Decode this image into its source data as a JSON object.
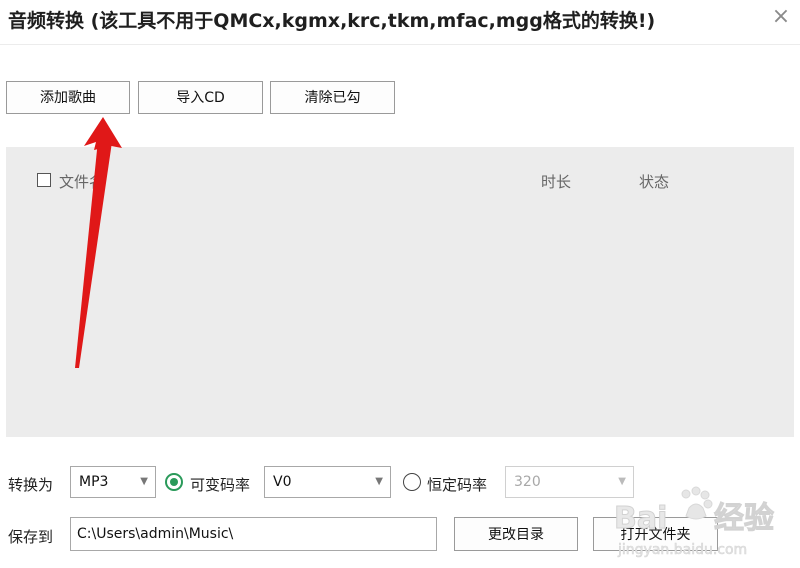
{
  "window": {
    "title": "音频转换 (该工具不用于QMCx,kgmx,krc,tkm,mfac,mgg格式的转换!)",
    "close_glyph": "×"
  },
  "toolbar": {
    "add_songs": "添加歌曲",
    "import_cd": "导入CD",
    "clear_checked": "清除已勾"
  },
  "file_list": {
    "columns": {
      "filename": "文件名",
      "duration": "时长",
      "status": "状态"
    }
  },
  "convert": {
    "label": "转换为",
    "format": "MP3",
    "vbr_label": "可变码率",
    "vbr_value": "V0",
    "cbr_label": "恒定码率",
    "cbr_value": "320",
    "mode": "vbr"
  },
  "save": {
    "label": "保存到",
    "path": "C:\\Users\\admin\\Music\\",
    "change_dir": "更改目录",
    "open_folder": "打开文件夹"
  },
  "colors": {
    "accent_green": "#2a9a5a",
    "arrow_red": "#e01818",
    "list_bg": "#ececec"
  }
}
